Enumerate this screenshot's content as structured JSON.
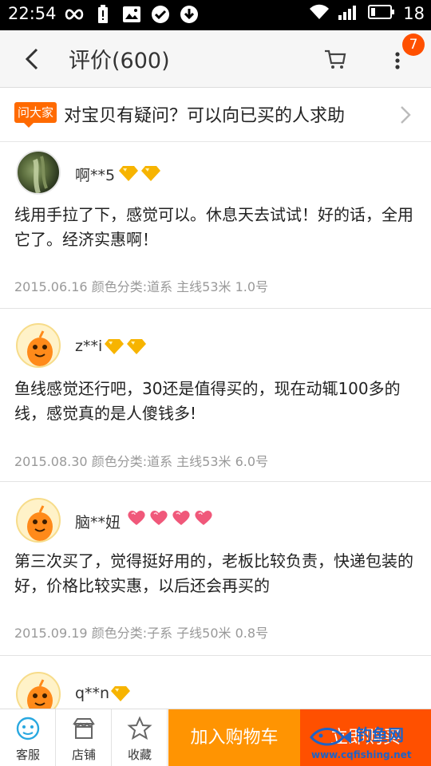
{
  "status_bar": {
    "time": "22:54",
    "battery_level": "18",
    "icons": [
      "infinity-icon",
      "battery-alert-icon",
      "image-icon",
      "check-circle-icon",
      "download-icon",
      "wifi-icon",
      "signal-icon",
      "battery-icon"
    ]
  },
  "header": {
    "title": "评价(600)",
    "cart_badge": "7",
    "icons": [
      "back-arrow-icon",
      "cart-icon",
      "more-icon"
    ]
  },
  "ask_banner": {
    "tag": "问大家",
    "text": "对宝贝有疑问？可以向已买的人求助"
  },
  "reviews": [
    {
      "user": "啊**5",
      "badge_type": "diamond",
      "badge_count": 2,
      "content": "线用手拉了下，感觉可以。休息天去试试！好的话，全用它了。经济实惠啊！",
      "meta": "2015.06.16 颜色分类:道系 主线53米 1.0号",
      "avatar": "photo"
    },
    {
      "user": "z**i",
      "badge_type": "diamond",
      "badge_count": 2,
      "content": "鱼线感觉还行吧，30还是值得买的，现在动辄100多的线，感觉真的是人傻钱多!",
      "meta": "2015.08.30 颜色分类:道系 主线53米 6.0号",
      "avatar": "mascot"
    },
    {
      "user": "脑**妞",
      "badge_type": "heart",
      "badge_count": 4,
      "content": "第三次买了，觉得挺好用的，老板比较负责，快递包装的好，价格比较实惠，以后还会再买的",
      "meta": "2015.09.19 颜色分类:子系 子线50米 0.8号",
      "avatar": "mascot"
    },
    {
      "user": "q**n",
      "badge_type": "diamond",
      "badge_count": 1,
      "content": "",
      "meta": "",
      "avatar": "mascot"
    }
  ],
  "bottom_bar": {
    "service_label": "客服",
    "shop_label": "店铺",
    "favorite_label": "收藏",
    "add_cart_label": "加入购物车",
    "buy_now_label": "立即购买"
  },
  "watermark": {
    "text": "钓鱼网",
    "url": "www.cqfishing.net"
  },
  "colors": {
    "accent_orange": "#ff9402",
    "accent_red": "#ff5000",
    "meta_gray": "#999999",
    "diamond_gold": "#f7b400",
    "heart_pink": "#f0587a"
  }
}
